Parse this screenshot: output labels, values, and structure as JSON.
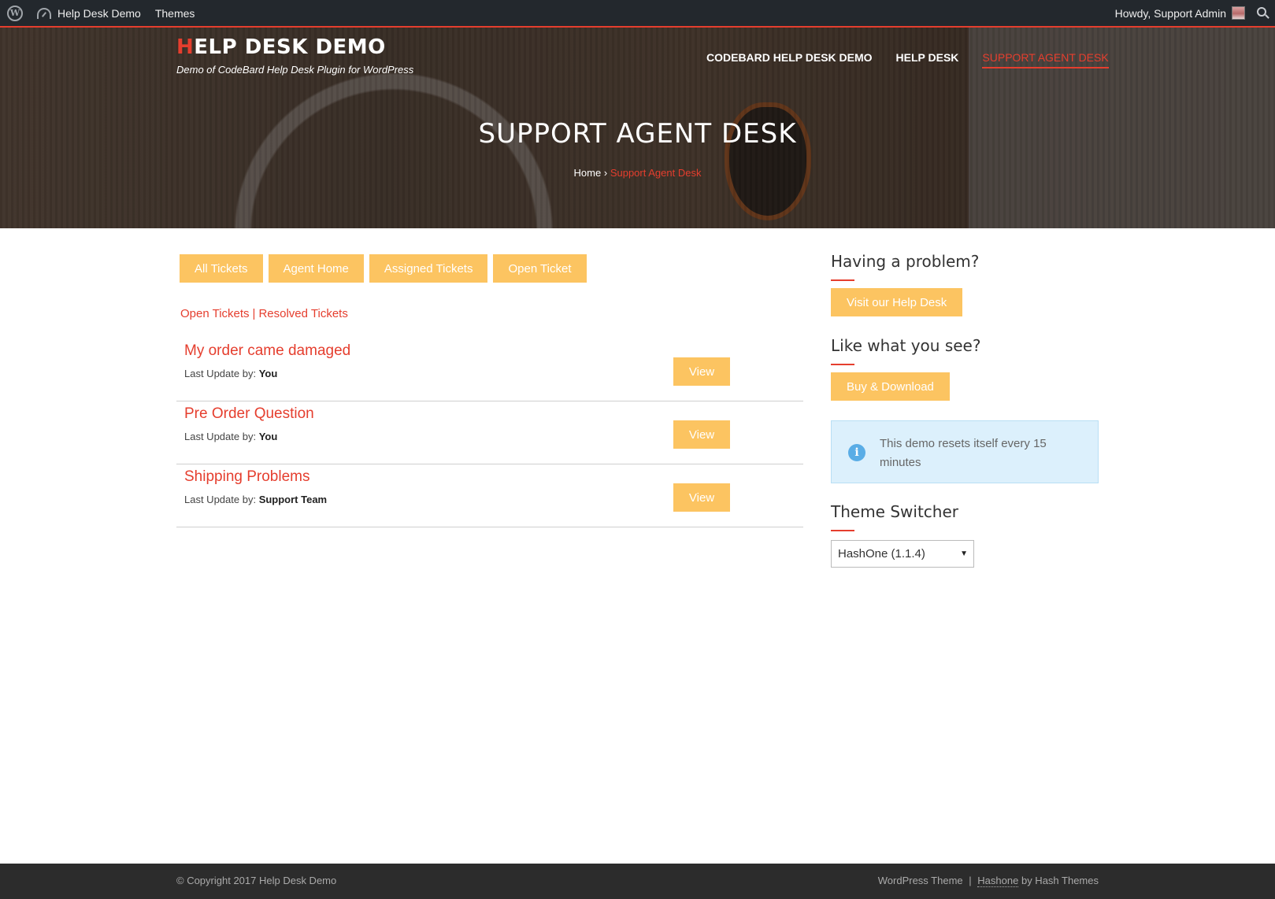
{
  "adminbar": {
    "site_name": "Help Desk Demo",
    "themes": "Themes",
    "howdy": "Howdy, Support Admin"
  },
  "header": {
    "title_first": "H",
    "title_rest": "ELP DESK DEMO",
    "tagline": "Demo of CodeBard Help Desk Plugin for WordPress",
    "nav": [
      "CODEBARD HELP DESK DEMO",
      "HELP DESK",
      "SUPPORT AGENT DESK"
    ],
    "page_title": "SUPPORT AGENT DESK",
    "breadcrumb_home": "Home",
    "breadcrumb_sep": "›",
    "breadcrumb_current": "Support Agent Desk"
  },
  "main": {
    "tabs": [
      "All Tickets",
      "Agent Home",
      "Assigned Tickets",
      "Open Ticket"
    ],
    "filters": {
      "open": "Open Tickets",
      "sep": "|",
      "resolved": "Resolved Tickets"
    },
    "last_update_label": "Last Update by:",
    "view_label": "View",
    "tickets": [
      {
        "title": "My order came damaged",
        "updated_by": "You"
      },
      {
        "title": "Pre Order Question",
        "updated_by": "You"
      },
      {
        "title": "Shipping Problems",
        "updated_by": "Support Team"
      }
    ]
  },
  "sidebar": {
    "problem_title": "Having a problem?",
    "problem_button": "Visit our Help Desk",
    "like_title": "Like what you see?",
    "like_button": "Buy & Download",
    "notice": "This demo resets itself every 15 minutes",
    "switcher_title": "Theme Switcher",
    "switcher_value": "HashOne (1.1.4)"
  },
  "footer": {
    "copyright": "© Copyright 2017 Help Desk Demo",
    "theme_text": "WordPress Theme",
    "sep": "|",
    "theme_link": "Hashone",
    "by_text": "by Hash Themes"
  },
  "colors": {
    "accent": "#e53e2e",
    "button": "#fcc461",
    "adminbar": "#23282d",
    "footer": "#2c2c2c"
  }
}
